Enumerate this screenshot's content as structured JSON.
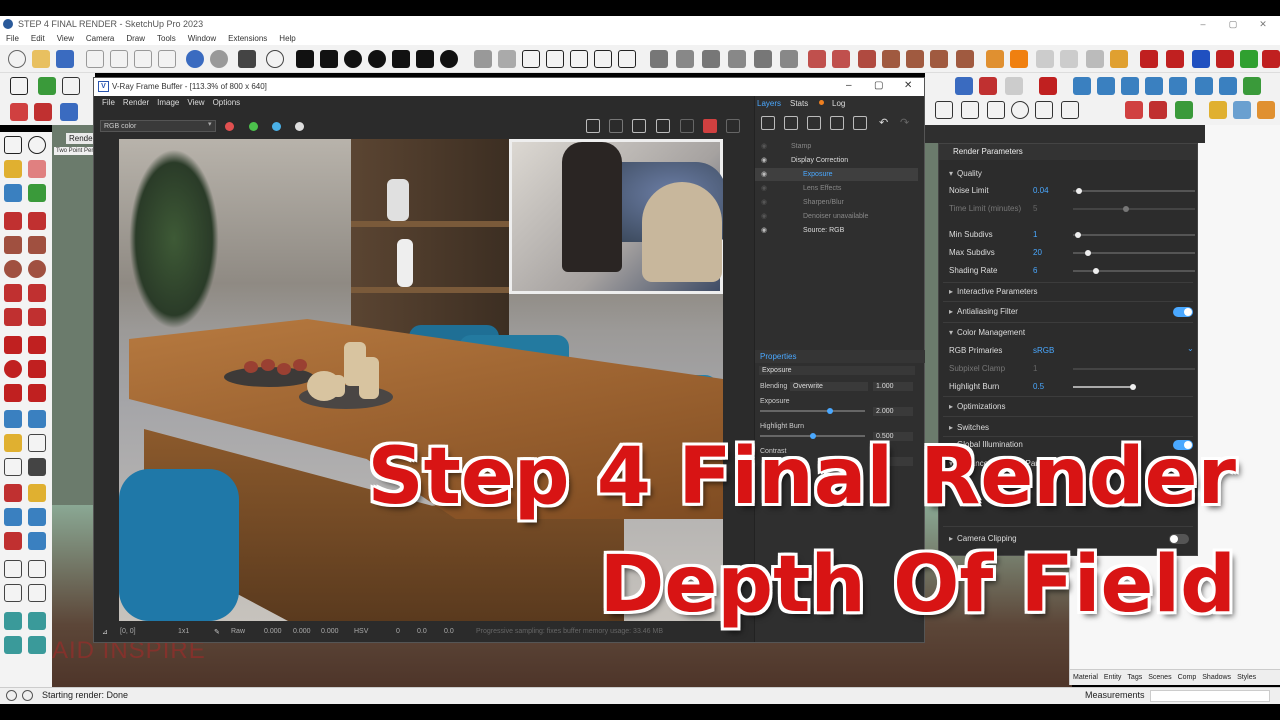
{
  "app": {
    "window_title": "STEP 4 FINAL RENDER - SketchUp Pro 2023",
    "menus": [
      "File",
      "Edit",
      "View",
      "Camera",
      "Draw",
      "Tools",
      "Window",
      "Extensions",
      "Help"
    ],
    "status": "Starting render: Done",
    "measurements_label": "Measurements",
    "tray_tabs": [
      "Material",
      "Entity",
      "Tags",
      "Scenes",
      "Comp",
      "Shadows",
      "Styles"
    ],
    "viewport_tab": "Rende",
    "viewport_camera": "Two Point Perspective",
    "watermark": "AID INSPIRE"
  },
  "vfb": {
    "title": "V-Ray Frame Buffer - [113.3% of 800 x 640]",
    "logo": "V",
    "menus": [
      "File",
      "Render",
      "Image",
      "View",
      "Options"
    ],
    "channel": "RGB color",
    "side_tabs": [
      "Layers",
      "Stats",
      "Log"
    ],
    "layers": [
      {
        "name": "Stamp",
        "visible": false,
        "selected": false
      },
      {
        "name": "Display Correction",
        "visible": true,
        "selected": false
      },
      {
        "name": "Exposure",
        "visible": true,
        "selected": true
      },
      {
        "name": "Lens Effects",
        "visible": false,
        "selected": false
      },
      {
        "name": "Sharpen/Blur",
        "visible": false,
        "selected": false
      },
      {
        "name": "Denoiser unavailable",
        "visible": false,
        "selected": false
      },
      {
        "name": "Source: RGB",
        "visible": true,
        "selected": false
      }
    ],
    "properties": {
      "title": "Properties",
      "layer_name": "Exposure",
      "blending_label": "Blending",
      "blending_mode": "Overwrite",
      "blending_value": "1.000",
      "exposure_label": "Exposure",
      "exposure_value": "2.000",
      "highlight_burn_label": "Highlight Burn",
      "highlight_burn_value": "0.500",
      "contrast_label": "Contrast",
      "contrast_value": ".50"
    },
    "bottom": {
      "coords": "[0, 0]",
      "zoom": "1x1",
      "raw_label": "Raw",
      "raw_values": [
        "0.000",
        "0.000",
        "0.000"
      ],
      "color_mode": "HSV",
      "hsv_values": [
        "0",
        "0.0",
        "0.0"
      ],
      "progress_text": "Progressive sampling: fixes buffer memory usage: 33.46 MB"
    },
    "dot_colors": [
      "#e05050",
      "#4cc04c",
      "#4ab0e6"
    ]
  },
  "render_params": {
    "title": "Render Parameters",
    "quality_label": "Quality",
    "noise_limit_label": "Noise Limit",
    "noise_limit": "0.04",
    "time_limit_label": "Time Limit (minutes)",
    "time_limit": "5",
    "min_subdivs_label": "Min Subdivs",
    "min_subdivs": "1",
    "max_subdivs_label": "Max Subdivs",
    "max_subdivs": "20",
    "shading_rate_label": "Shading Rate",
    "shading_rate": "6",
    "interactive_label": "Interactive Parameters",
    "antialiasing_label": "Antialiasing Filter",
    "color_mgmt_label": "Color Management",
    "rgb_primaries_label": "RGB Primaries",
    "rgb_primaries": "sRGB",
    "subpixel_clamp_label": "Subpixel Clamp",
    "subpixel_clamp": "1",
    "highlight_burn_label": "Highlight Burn",
    "highlight_burn": "0.5",
    "optimizations_label": "Optimizations",
    "switches_label": "Switches",
    "gi_label": "Global Illumination",
    "advanced_label": "Advanced Camera Parameters",
    "camera_clipping_label": "Camera Clipping",
    "antialiasing_on": true,
    "gi_on": true,
    "camera_clipping_on": false
  },
  "overlay": {
    "line1": "Step 4 Final Render",
    "line2": "Depth Of Field",
    "color": "#d81414"
  }
}
